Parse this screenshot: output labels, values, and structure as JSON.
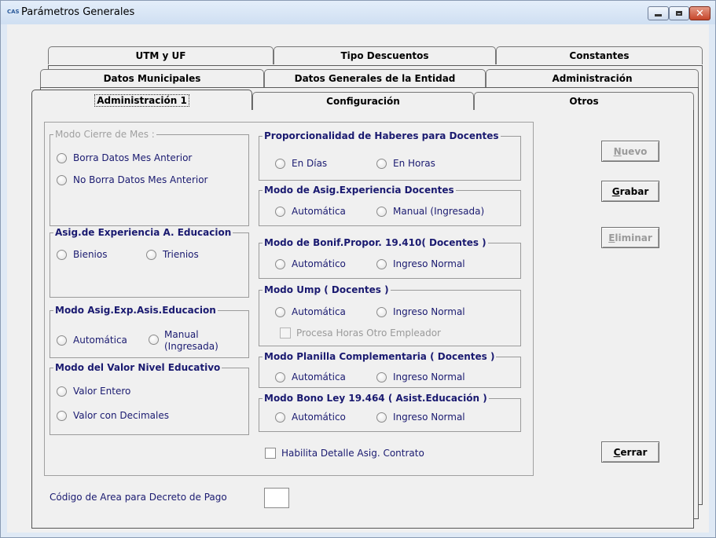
{
  "window": {
    "title": "Parámetros Generales",
    "app_icon": "cas-app-icon",
    "icon_text": "CAS",
    "controls": [
      "minimize-icon",
      "maximize-icon",
      "close-icon"
    ]
  },
  "tabs": {
    "row1": [
      "UTM y UF",
      "Tipo Descuentos",
      "Constantes"
    ],
    "row2": [
      "Datos Municipales",
      "Datos Generales de la Entidad",
      "Administración"
    ],
    "row3": [
      "Administración 1",
      "Configuración",
      "Otros"
    ],
    "active": "Administración 1"
  },
  "groups": {
    "modo_cierre": {
      "legend": "Modo Cierre de Mes :",
      "disabled": true,
      "options": [
        "Borra Datos Mes Anterior",
        "No Borra Datos Mes Anterior"
      ]
    },
    "asig_experiencia_educacion": {
      "legend": "Asig.de Experiencia A. Educacion",
      "options": [
        "Bienios",
        "Trienios"
      ]
    },
    "modo_asig_exp_asis": {
      "legend": "Modo Asig.Exp.Asis.Educacion",
      "options": [
        "Automática",
        "Manual",
        "(Ingresada)"
      ]
    },
    "modo_valor_nivel": {
      "legend": "Modo del Valor Nivel Educativo",
      "options": [
        "Valor Entero",
        "Valor con Decimales"
      ]
    },
    "proporcionalidad": {
      "legend": "Proporcionalidad de Haberes para Docentes",
      "options": [
        "En Días",
        "En Horas"
      ]
    },
    "modo_asig_exp_docentes": {
      "legend": "Modo de Asig.Experiencia Docentes",
      "options": [
        "Automática",
        "Manual (Ingresada)"
      ]
    },
    "modo_bonif": {
      "legend": "Modo de Bonif.Propor. 19.410( Docentes )",
      "options": [
        "Automático",
        "Ingreso Normal"
      ]
    },
    "modo_ump": {
      "legend": "Modo Ump ( Docentes )",
      "options": [
        "Automática",
        "Ingreso Normal"
      ],
      "checkbox": "Procesa Horas Otro Empleador"
    },
    "modo_planilla": {
      "legend": "Modo Planilla Complementaria ( Docentes )",
      "options": [
        "Automática",
        "Ingreso Normal"
      ]
    },
    "modo_bono": {
      "legend": "Modo Bono Ley 19.464 ( Asist.Educación )",
      "options": [
        "Automático",
        "Ingreso Normal"
      ]
    }
  },
  "habilita_detalle": "Habilita Detalle Asig. Contrato",
  "codigo_area": {
    "label": "Código de Area para Decreto de Pago",
    "value": ""
  },
  "buttons": {
    "nuevo": {
      "mnemonic": "N",
      "rest": "uevo",
      "disabled": true
    },
    "grabar": {
      "mnemonic": "G",
      "rest": "rabar",
      "disabled": false
    },
    "eliminar": {
      "mnemonic": "E",
      "rest": "liminar",
      "disabled": true
    },
    "cerrar": {
      "mnemonic": "C",
      "rest": "errar",
      "disabled": false
    }
  }
}
